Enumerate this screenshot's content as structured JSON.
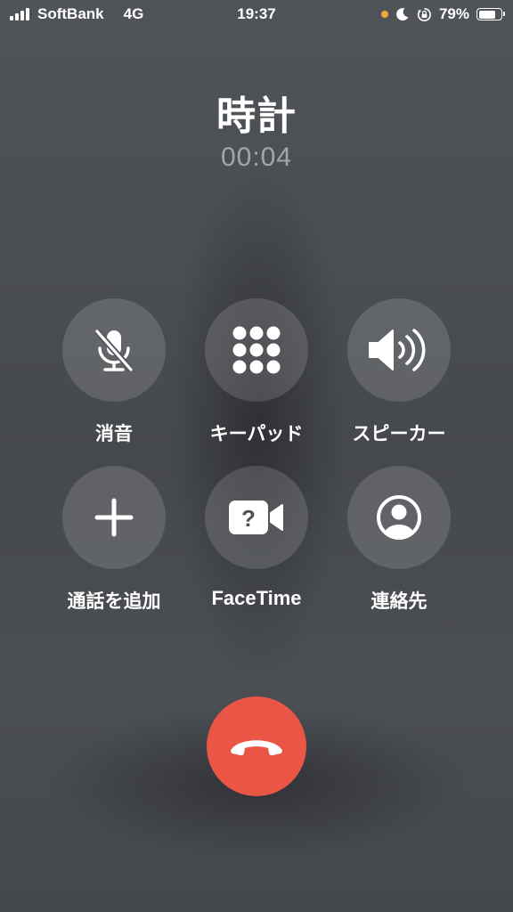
{
  "status_bar": {
    "carrier": "SoftBank",
    "network": "4G",
    "time": "19:37",
    "battery_percent": "79%",
    "battery_level": 0.79,
    "icons": [
      "signal-icon",
      "orange-dot-indicator",
      "moon-icon",
      "rotation-lock-icon",
      "battery-icon"
    ]
  },
  "call": {
    "caller": "時計",
    "duration": "00:04"
  },
  "controls": {
    "mute": "消音",
    "keypad": "キーパッド",
    "speaker": "スピーカー",
    "add_call": "通話を追加",
    "facetime": "FaceTime",
    "contacts": "連絡先"
  },
  "icons": {
    "mute": "mic-slash-icon",
    "keypad": "keypad-icon",
    "speaker": "speaker-wave-icon",
    "add_call": "plus-icon",
    "facetime": "video-question-icon",
    "contacts": "person-circle-icon",
    "end_call": "phone-down-icon"
  },
  "colors": {
    "end_call": "#eb5545",
    "indicator_dot": "#f7a23b"
  }
}
